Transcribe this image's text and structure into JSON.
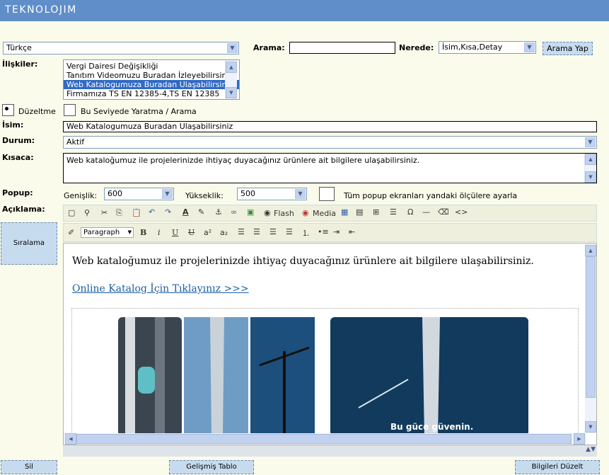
{
  "app": {
    "logo": "TEKNOLOJIM"
  },
  "search": {
    "language": "Türkçe",
    "arama_label": "Arama:",
    "arama_value": "",
    "nerede_label": "Nerede:",
    "nerede_value": "İsim,Kısa,Detay",
    "button": "Arama Yap"
  },
  "relations": {
    "label": "İlişkiler:",
    "items": [
      "Vergi Dairesi Değişikliği",
      "Tanıtım Videomuzu Buradan İzleyebilirsiniz",
      "Web Katalogumuza Buradan Ulaşabilirsiniz",
      "Firmamıza TS EN 12385-4,TS EN 12385"
    ],
    "selected_index": 2
  },
  "mode": {
    "edit_label": "Düzeltme",
    "create_label": "Bu Seviyede Yaratma / Arama",
    "selected": "edit"
  },
  "form": {
    "name_label": "İsim:",
    "name_value": "Web Katalogumuza Buradan Ulaşabilirsiniz",
    "status_label": "Durum:",
    "status_value": "Aktif",
    "short_label": "Kısaca:",
    "short_value": "Web kataloğumuz ile projelerinizde ihtiyaç duyacağınız ürünlere ait bilgilere ulaşabilirsiniz.",
    "popup_label": "Popup:",
    "width_label": "Genişlik:",
    "width_value": "600",
    "height_label": "Yükseklik:",
    "height_value": "500",
    "popup_all_label": "Tüm popup ekranları yandaki ölçülere ayarla",
    "desc_label": "Açıklama:"
  },
  "editor": {
    "flash_label": "Flash",
    "media_label": "Media",
    "format_value": "Paragraph",
    "body_text": "Web kataloğumuz ile projelerinizde ihtiyaç duyacağınız ürünlere ait bilgilere ulaşabilirsiniz.",
    "link_text": "Online Katalog İçin Tıklayınız >>>",
    "banner_caption": "Bu güce güvenin."
  },
  "buttons": {
    "siralama": "Sıralama",
    "sil": "Sil",
    "gelismis": "Gelişmiş Tablo",
    "duzelt": "Bilgileri Düzelt"
  },
  "colors": {
    "topbar": "#5f8ec9",
    "page_bg": "#fbfbeb",
    "button_bg": "#c7dbef",
    "selection": "#316ac5",
    "link": "#1a5fa8"
  }
}
